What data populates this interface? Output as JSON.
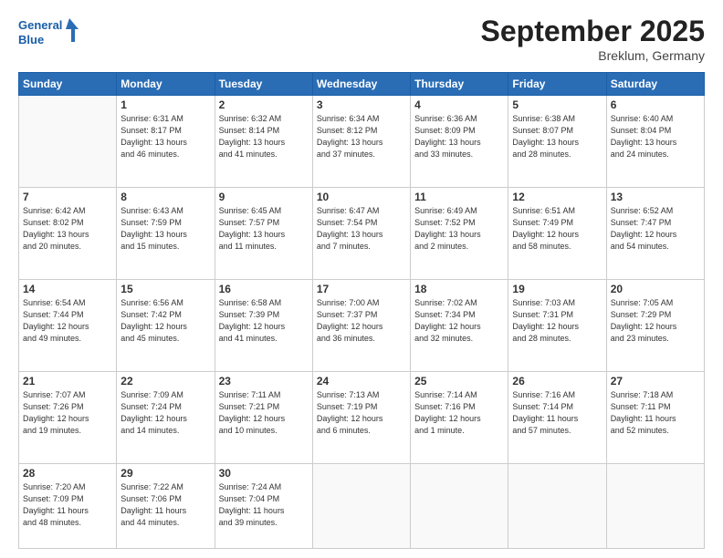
{
  "header": {
    "logo_line1": "General",
    "logo_line2": "Blue",
    "month_title": "September 2025",
    "location": "Breklum, Germany"
  },
  "weekdays": [
    "Sunday",
    "Monday",
    "Tuesday",
    "Wednesday",
    "Thursday",
    "Friday",
    "Saturday"
  ],
  "weeks": [
    [
      {
        "day": "",
        "info": ""
      },
      {
        "day": "1",
        "info": "Sunrise: 6:31 AM\nSunset: 8:17 PM\nDaylight: 13 hours\nand 46 minutes."
      },
      {
        "day": "2",
        "info": "Sunrise: 6:32 AM\nSunset: 8:14 PM\nDaylight: 13 hours\nand 41 minutes."
      },
      {
        "day": "3",
        "info": "Sunrise: 6:34 AM\nSunset: 8:12 PM\nDaylight: 13 hours\nand 37 minutes."
      },
      {
        "day": "4",
        "info": "Sunrise: 6:36 AM\nSunset: 8:09 PM\nDaylight: 13 hours\nand 33 minutes."
      },
      {
        "day": "5",
        "info": "Sunrise: 6:38 AM\nSunset: 8:07 PM\nDaylight: 13 hours\nand 28 minutes."
      },
      {
        "day": "6",
        "info": "Sunrise: 6:40 AM\nSunset: 8:04 PM\nDaylight: 13 hours\nand 24 minutes."
      }
    ],
    [
      {
        "day": "7",
        "info": "Sunrise: 6:42 AM\nSunset: 8:02 PM\nDaylight: 13 hours\nand 20 minutes."
      },
      {
        "day": "8",
        "info": "Sunrise: 6:43 AM\nSunset: 7:59 PM\nDaylight: 13 hours\nand 15 minutes."
      },
      {
        "day": "9",
        "info": "Sunrise: 6:45 AM\nSunset: 7:57 PM\nDaylight: 13 hours\nand 11 minutes."
      },
      {
        "day": "10",
        "info": "Sunrise: 6:47 AM\nSunset: 7:54 PM\nDaylight: 13 hours\nand 7 minutes."
      },
      {
        "day": "11",
        "info": "Sunrise: 6:49 AM\nSunset: 7:52 PM\nDaylight: 13 hours\nand 2 minutes."
      },
      {
        "day": "12",
        "info": "Sunrise: 6:51 AM\nSunset: 7:49 PM\nDaylight: 12 hours\nand 58 minutes."
      },
      {
        "day": "13",
        "info": "Sunrise: 6:52 AM\nSunset: 7:47 PM\nDaylight: 12 hours\nand 54 minutes."
      }
    ],
    [
      {
        "day": "14",
        "info": "Sunrise: 6:54 AM\nSunset: 7:44 PM\nDaylight: 12 hours\nand 49 minutes."
      },
      {
        "day": "15",
        "info": "Sunrise: 6:56 AM\nSunset: 7:42 PM\nDaylight: 12 hours\nand 45 minutes."
      },
      {
        "day": "16",
        "info": "Sunrise: 6:58 AM\nSunset: 7:39 PM\nDaylight: 12 hours\nand 41 minutes."
      },
      {
        "day": "17",
        "info": "Sunrise: 7:00 AM\nSunset: 7:37 PM\nDaylight: 12 hours\nand 36 minutes."
      },
      {
        "day": "18",
        "info": "Sunrise: 7:02 AM\nSunset: 7:34 PM\nDaylight: 12 hours\nand 32 minutes."
      },
      {
        "day": "19",
        "info": "Sunrise: 7:03 AM\nSunset: 7:31 PM\nDaylight: 12 hours\nand 28 minutes."
      },
      {
        "day": "20",
        "info": "Sunrise: 7:05 AM\nSunset: 7:29 PM\nDaylight: 12 hours\nand 23 minutes."
      }
    ],
    [
      {
        "day": "21",
        "info": "Sunrise: 7:07 AM\nSunset: 7:26 PM\nDaylight: 12 hours\nand 19 minutes."
      },
      {
        "day": "22",
        "info": "Sunrise: 7:09 AM\nSunset: 7:24 PM\nDaylight: 12 hours\nand 14 minutes."
      },
      {
        "day": "23",
        "info": "Sunrise: 7:11 AM\nSunset: 7:21 PM\nDaylight: 12 hours\nand 10 minutes."
      },
      {
        "day": "24",
        "info": "Sunrise: 7:13 AM\nSunset: 7:19 PM\nDaylight: 12 hours\nand 6 minutes."
      },
      {
        "day": "25",
        "info": "Sunrise: 7:14 AM\nSunset: 7:16 PM\nDaylight: 12 hours\nand 1 minute."
      },
      {
        "day": "26",
        "info": "Sunrise: 7:16 AM\nSunset: 7:14 PM\nDaylight: 11 hours\nand 57 minutes."
      },
      {
        "day": "27",
        "info": "Sunrise: 7:18 AM\nSunset: 7:11 PM\nDaylight: 11 hours\nand 52 minutes."
      }
    ],
    [
      {
        "day": "28",
        "info": "Sunrise: 7:20 AM\nSunset: 7:09 PM\nDaylight: 11 hours\nand 48 minutes."
      },
      {
        "day": "29",
        "info": "Sunrise: 7:22 AM\nSunset: 7:06 PM\nDaylight: 11 hours\nand 44 minutes."
      },
      {
        "day": "30",
        "info": "Sunrise: 7:24 AM\nSunset: 7:04 PM\nDaylight: 11 hours\nand 39 minutes."
      },
      {
        "day": "",
        "info": ""
      },
      {
        "day": "",
        "info": ""
      },
      {
        "day": "",
        "info": ""
      },
      {
        "day": "",
        "info": ""
      }
    ]
  ]
}
